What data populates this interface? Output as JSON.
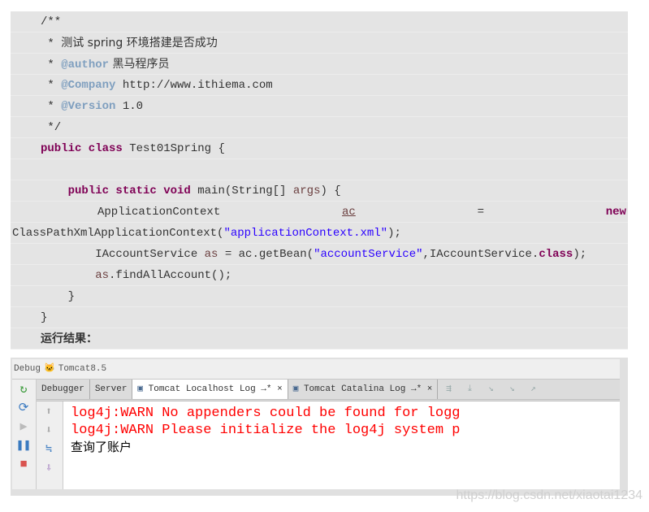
{
  "code": {
    "l1": "/**",
    "l2_star": " * ",
    "l2_text": "测试 spring 环境搭建是否成功",
    "l3_tag": "@author",
    "l3_text": " 黑马程序员",
    "l4_tag": "@Company",
    "l4_text": " http://www.ithiema.com",
    "l5_tag": "@Version",
    "l5_text": " 1.0",
    "l6": " */",
    "l7_kw": "public class",
    "l7_text": " Test01Spring {",
    "l9_kw": "public static void",
    "l9_text": " main(String[] ",
    "l9_var": "args",
    "l9_end": ") {",
    "l10_a": "ApplicationContext",
    "l10_b": "ac",
    "l10_c": "=",
    "l10_d": "new",
    "l11_a": "ClassPathXmlApplicationContext(",
    "l11_str": "\"applicationContext.xml\"",
    "l11_end": ");",
    "l12_a": "IAccountService ",
    "l12_var": "as",
    "l12_b": " = ac.getBean(",
    "l12_str": "\"accountService\"",
    "l12_c": ",IAccountService.",
    "l12_kw": "class",
    "l12_end": ");",
    "l13_var": "as",
    "l13_text": ".findAllAccount();",
    "l14": "}",
    "l15": "}",
    "result_label": "运行结果："
  },
  "debug": {
    "title": "Debug",
    "config": "Tomcat8.5",
    "tabs": [
      "Debugger",
      "Server",
      "Tomcat Localhost Log",
      "Tomcat Catalina Log"
    ],
    "console": [
      "log4j:WARN No appenders could be found for logg",
      "log4j:WARN Please initialize the log4j system p",
      "查询了账户"
    ]
  },
  "watermark": "https://blog.csdn.net/xiaotai1234"
}
